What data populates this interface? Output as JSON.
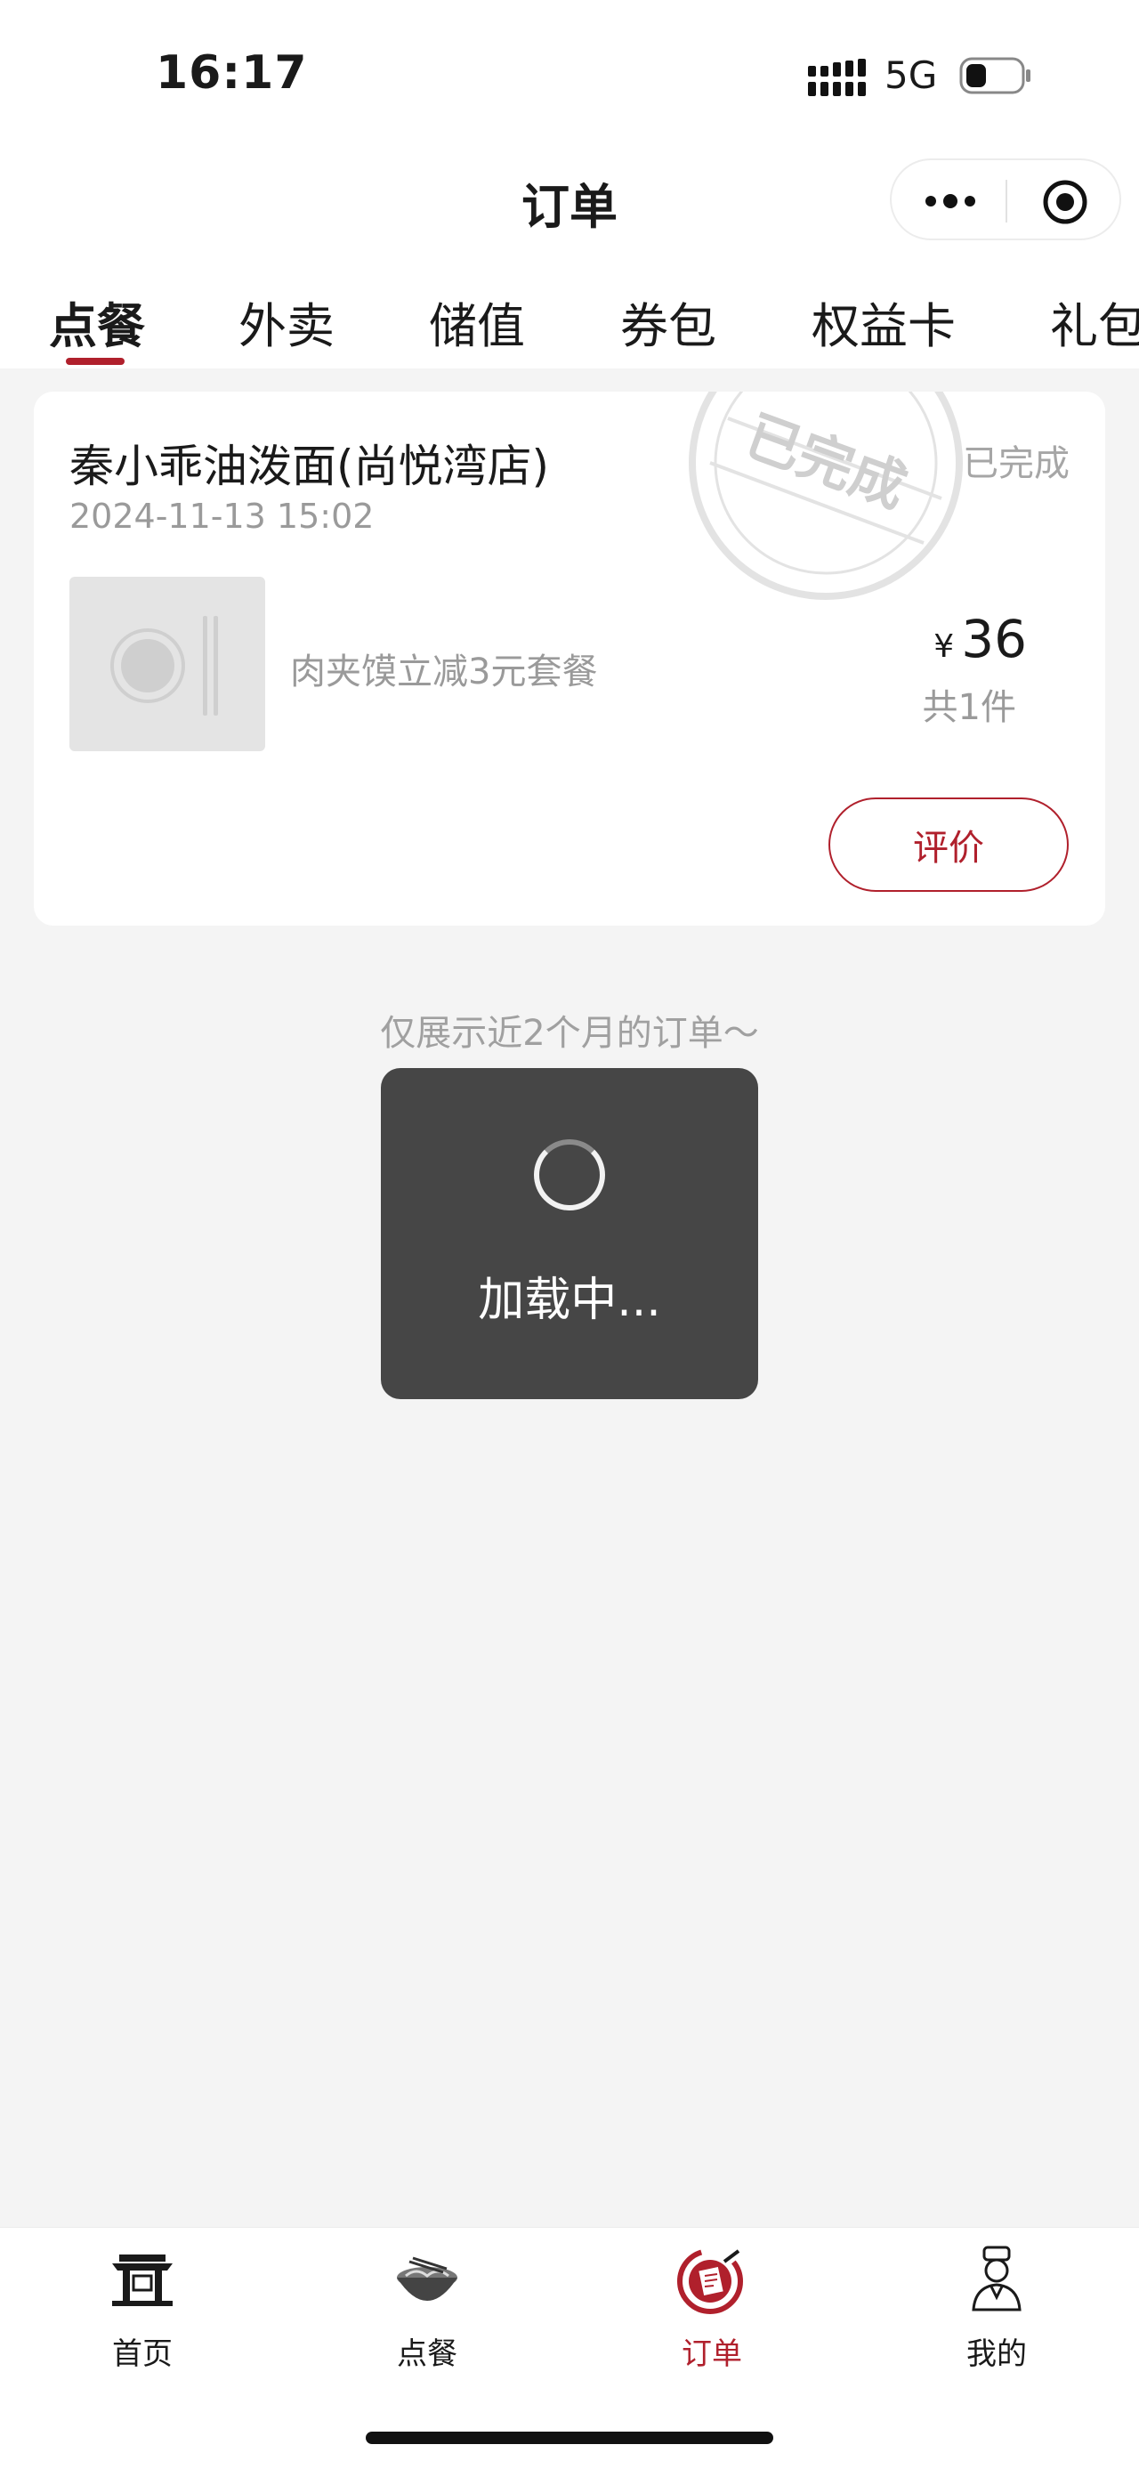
{
  "status_bar": {
    "time": "16:17",
    "network": "5G"
  },
  "nav": {
    "title": "订单"
  },
  "tabs": [
    {
      "label": "点餐",
      "active": true
    },
    {
      "label": "外卖"
    },
    {
      "label": "储值"
    },
    {
      "label": "券包"
    },
    {
      "label": "权益卡"
    },
    {
      "label": "礼包"
    }
  ],
  "order": {
    "store_name": "秦小乖油泼面(尚悦湾店)",
    "time": "2024-11-13 15:02",
    "status": "已完成",
    "stamp_text": "已完成",
    "item_name": "肉夹馍立减3元套餐",
    "currency": "¥",
    "price": "36",
    "quantity": "共1件",
    "review_label": "评价"
  },
  "footer_note": "仅展示近2个月的订单～",
  "loading": {
    "text": "加载中..."
  },
  "tabbar": [
    {
      "label": "首页",
      "icon": "shop-gate-icon"
    },
    {
      "label": "点餐",
      "icon": "noodle-bowl-icon"
    },
    {
      "label": "订单",
      "icon": "order-note-icon",
      "active": true
    },
    {
      "label": "我的",
      "icon": "chef-person-icon"
    }
  ],
  "colors": {
    "accent": "#b0202c",
    "background": "#f4f4f4",
    "toast": "#464646"
  }
}
